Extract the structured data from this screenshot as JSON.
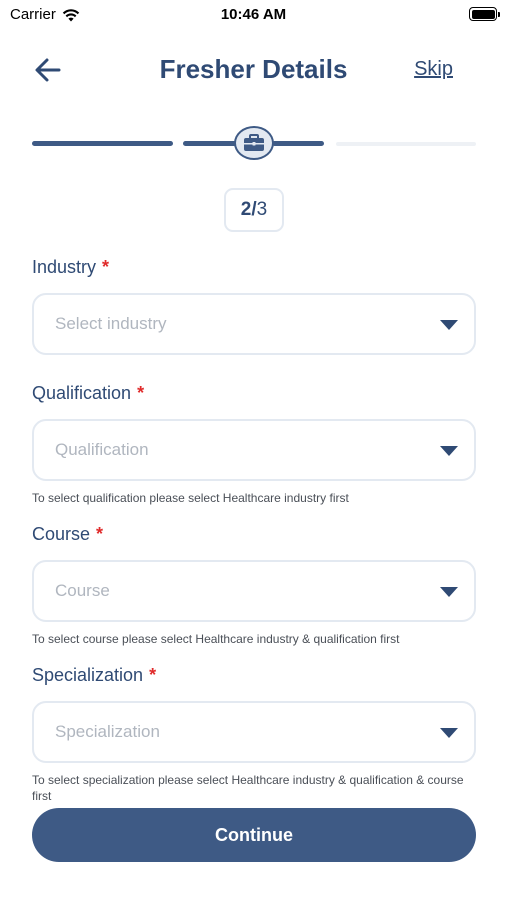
{
  "status_bar": {
    "carrier": "Carrier",
    "time": "10:46 AM"
  },
  "header": {
    "title": "Fresher Details",
    "skip_label": "Skip"
  },
  "progress": {
    "current_step": "2/",
    "total_steps": "3"
  },
  "form": {
    "industry": {
      "label": "Industry",
      "required": "*",
      "placeholder": "Select industry"
    },
    "qualification": {
      "label": "Qualification",
      "required": "*",
      "placeholder": "Qualification",
      "hint": "To select qualification please select Healthcare industry first"
    },
    "course": {
      "label": "Course",
      "required": "*",
      "placeholder": "Course",
      "hint": "To select course please select Healthcare industry & qualification first"
    },
    "specialization": {
      "label": "Specialization",
      "required": "*",
      "placeholder": "Specialization",
      "hint": "To select specialization please select Healthcare industry & qualification & course first"
    }
  },
  "actions": {
    "continue_label": "Continue"
  },
  "colors": {
    "primary": "#3e5a85",
    "title": "#2f4a74",
    "required": "#e02b2b",
    "border": "#e3e9f1",
    "placeholder": "#b0b6bf"
  }
}
